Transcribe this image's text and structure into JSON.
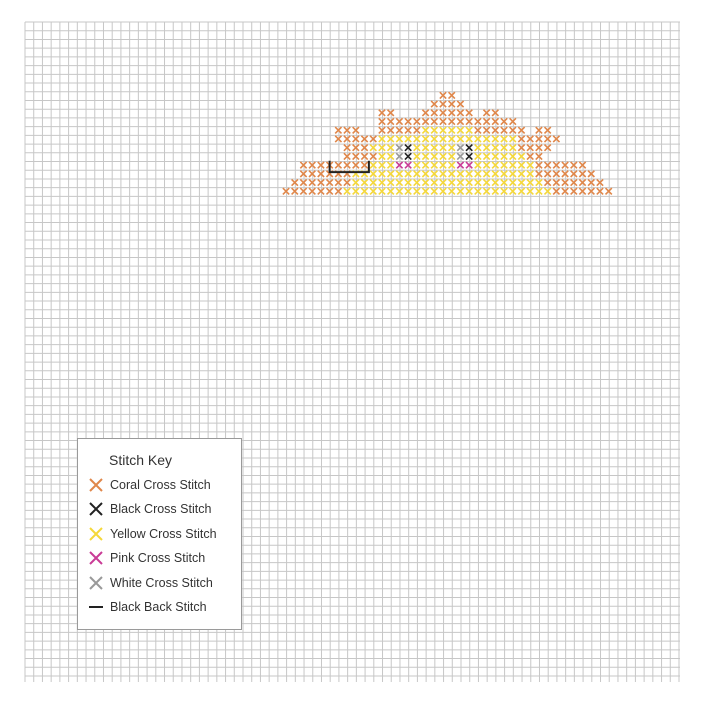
{
  "pattern": {
    "fabric_grid_color": "#c7c7c7",
    "rows": [
      {
        "row": 0,
        "runs": [
          [
            "C",
            12,
            13
          ]
        ]
      },
      {
        "row": 1,
        "runs": [
          [
            "C",
            11,
            14
          ]
        ]
      },
      {
        "row": 2,
        "runs": [
          [
            "C",
            5,
            6
          ],
          [
            "C",
            10,
            15
          ],
          [
            "C",
            17,
            18
          ]
        ]
      },
      {
        "row": 3,
        "runs": [
          [
            "C",
            5,
            8
          ],
          [
            "C",
            9,
            20
          ]
        ]
      },
      {
        "row": 4,
        "runs": [
          [
            "C",
            0,
            2
          ],
          [
            "C",
            5,
            9
          ],
          [
            "Y",
            10,
            15
          ],
          [
            "C",
            16,
            21
          ],
          [
            "C",
            23,
            24
          ]
        ]
      },
      {
        "row": 5,
        "runs": [
          [
            "C",
            0,
            4
          ],
          [
            "Y",
            5,
            20
          ],
          [
            "C",
            21,
            25
          ]
        ]
      },
      {
        "row": 6,
        "runs": [
          [
            "C",
            1,
            3
          ],
          [
            "Y",
            4,
            6
          ],
          [
            "W",
            7,
            7
          ],
          [
            "B",
            8,
            8
          ],
          [
            "Y",
            9,
            13
          ],
          [
            "W",
            14,
            14
          ],
          [
            "B",
            15,
            15
          ],
          [
            "Y",
            16,
            20
          ],
          [
            "C",
            21,
            24
          ]
        ]
      },
      {
        "row": 7,
        "runs": [
          [
            "C",
            1,
            4
          ],
          [
            "Y",
            5,
            6
          ],
          [
            "W",
            7,
            7
          ],
          [
            "B",
            8,
            8
          ],
          [
            "Y",
            9,
            13
          ],
          [
            "W",
            14,
            14
          ],
          [
            "B",
            15,
            15
          ],
          [
            "Y",
            16,
            21
          ],
          [
            "C",
            22,
            23
          ]
        ]
      },
      {
        "row": 8,
        "runs": [
          [
            "C",
            -4,
            -1
          ],
          [
            "C",
            0,
            3
          ],
          [
            "Y",
            4,
            6
          ],
          [
            "P",
            7,
            8
          ],
          [
            "Y",
            9,
            13
          ],
          [
            "P",
            14,
            15
          ],
          [
            "Y",
            16,
            22
          ],
          [
            "C",
            23,
            28
          ]
        ]
      },
      {
        "row": 9,
        "runs": [
          [
            "C",
            -4,
            1
          ],
          [
            "Y",
            2,
            22
          ],
          [
            "C",
            23,
            29
          ]
        ]
      },
      {
        "row": 10,
        "runs": [
          [
            "C",
            -5,
            1
          ],
          [
            "Y",
            2,
            23
          ],
          [
            "C",
            24,
            30
          ]
        ]
      },
      {
        "row": 11,
        "runs": [
          [
            "C",
            -6,
            0
          ],
          [
            "Y",
            1,
            24
          ],
          [
            "C",
            25,
            31
          ]
        ]
      }
    ],
    "backstitch": "Black"
  },
  "stitch_key": {
    "title": "Stitch Key",
    "items": [
      {
        "label": "Coral Cross Stitch",
        "color": "#e0874a",
        "kind": "cross"
      },
      {
        "label": "Black Cross Stitch",
        "color": "#222222",
        "kind": "cross"
      },
      {
        "label": "Yellow Cross Stitch",
        "color": "#f5d83a",
        "kind": "cross"
      },
      {
        "label": "Pink Cross Stitch",
        "color": "#c93c96",
        "kind": "cross"
      },
      {
        "label": "White Cross Stitch",
        "color": "#999999",
        "kind": "cross"
      },
      {
        "label": "Black Back Stitch",
        "color": "#222222",
        "kind": "back"
      }
    ]
  }
}
